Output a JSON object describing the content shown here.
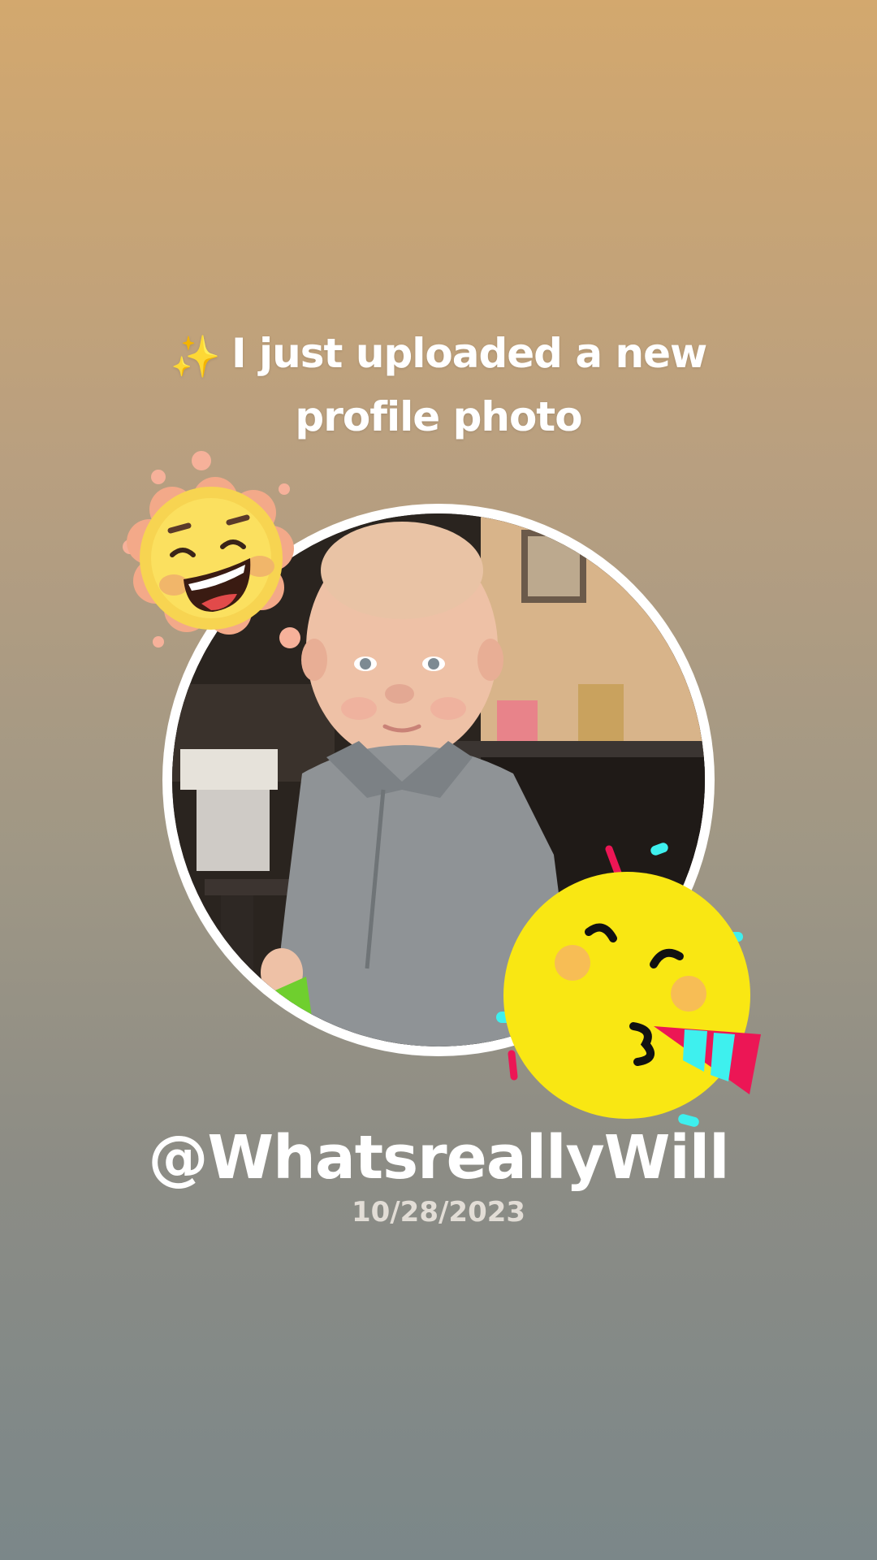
{
  "headline": {
    "sparkle_icon": "✨",
    "line1": "I just uploaded a new",
    "line2": "profile photo"
  },
  "profile": {
    "username": "@WhatsreallyWill",
    "date": "10/28/2023"
  },
  "stickers": {
    "top_left": "laughing-sun-sticker",
    "bottom_right": "party-face-sticker"
  },
  "colors": {
    "background_top": "#d3a86e",
    "background_bottom": "#7b8789",
    "ring": "#ffffff",
    "text": "#ffffff",
    "date_text": "#e2ddd6",
    "party_yellow": "#f9e713",
    "party_pink": "#ec1655",
    "party_cyan": "#3ef0ee"
  }
}
